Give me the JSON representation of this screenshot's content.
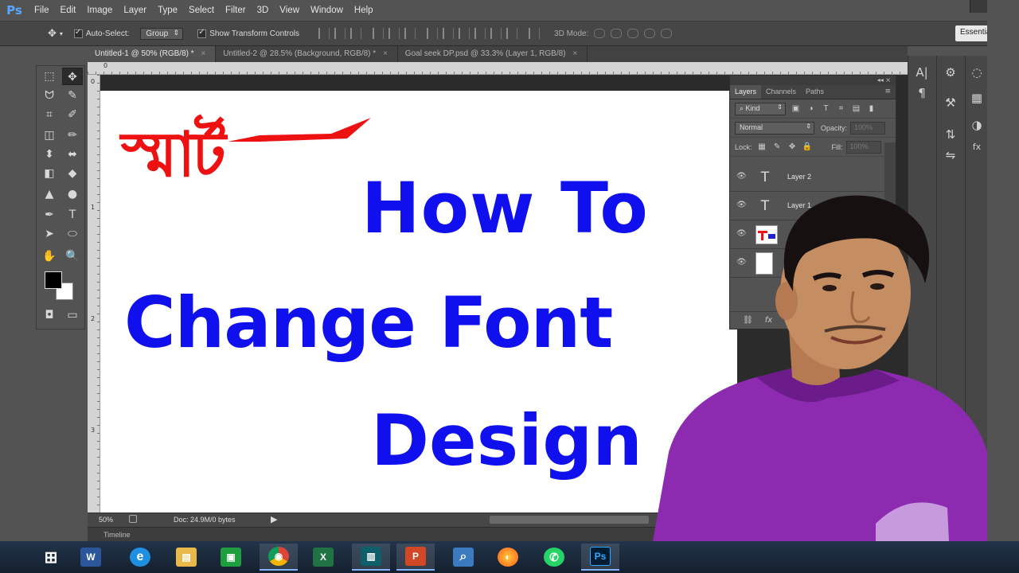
{
  "app": {
    "logo_text": "Ps",
    "menu": [
      "File",
      "Edit",
      "Image",
      "Layer",
      "Type",
      "Select",
      "Filter",
      "3D",
      "View",
      "Window",
      "Help"
    ]
  },
  "options_bar": {
    "auto_select_label": "Auto-Select:",
    "auto_select_target": "Group",
    "show_transform_label": "Show Transform Controls",
    "three_d_mode_label": "3D Mode:",
    "workspace_label": "Essentials"
  },
  "tabs": [
    {
      "label": "Untitled-1 @ 50% (RGB/8) *",
      "active": true
    },
    {
      "label": "Untitled-2 @ 28.5% (Background, RGB/8) *",
      "active": false
    },
    {
      "label": "Goal seek DP.psd @ 33.3% (Layer 1, RGB/8)",
      "active": false
    }
  ],
  "tab_close_glyph": "×",
  "rulers": {
    "top_first_tick": "0",
    "left_ticks": [
      "0",
      "1",
      "2",
      "3"
    ]
  },
  "canvas": {
    "bangla_word": "স্মার্ট",
    "headline_1": "How To",
    "headline_2": "Change Font",
    "headline_3": "Design",
    "headline_color": "#1010ee",
    "bangla_color": "#ee1111"
  },
  "status": {
    "zoom": "50%",
    "doc_info": "Doc: 24.9M/0 bytes",
    "arrow": "▶"
  },
  "timeline_label": "Timeline",
  "layers_panel": {
    "collapse_glyph": "◂◂  ×",
    "tabs": [
      "Layers",
      "Channels",
      "Paths"
    ],
    "menu_glyph": "≡",
    "filter_kind": "Kind",
    "blend_mode": "Normal",
    "opacity_label": "Opacity:",
    "opacity_value": "100%",
    "lock_label": "Lock:",
    "fill_label": "Fill:",
    "fill_value": "100%",
    "layers": [
      {
        "name": "Layer 2",
        "thumb": "T"
      },
      {
        "name": "Layer 1",
        "thumb": "T"
      },
      {
        "name": "",
        "thumb": "img"
      },
      {
        "name": "",
        "thumb": "bg"
      }
    ],
    "eye_glyph": "👁"
  },
  "tools": {
    "glyphs": [
      "⬚",
      "✥",
      "ᗢ",
      "✎",
      "⌗",
      "✐",
      "◫",
      "✏",
      "⬍",
      "⬌",
      "◧",
      "◆",
      "▲",
      "●",
      "✒",
      "T",
      "➤",
      "⬭",
      "✋",
      "🔍"
    ],
    "quickmask_glyph": "◘",
    "screenmode_glyph": "▭"
  },
  "dock": {
    "col1": [
      "A|",
      "¶"
    ],
    "col2": [
      "⚙",
      "⚒",
      "⇅",
      "⇋"
    ],
    "col3": [
      "◌",
      "▦",
      "◑",
      "fx"
    ]
  },
  "taskbar": {
    "apps": [
      {
        "name": "windows-start",
        "label": "⊞",
        "color": "#ffffff"
      },
      {
        "name": "word",
        "label": "W",
        "color": "#2b579a"
      },
      {
        "name": "internet-explorer",
        "label": "e",
        "color": "#1e8fe1"
      },
      {
        "name": "file-explorer",
        "label": "▤",
        "color": "#e8b84a"
      },
      {
        "name": "store",
        "label": "▣",
        "color": "#1e9e3e"
      },
      {
        "name": "chrome",
        "label": "◉",
        "color": "#db4437"
      },
      {
        "name": "excel",
        "label": "X",
        "color": "#1f7244"
      },
      {
        "name": "book-reader",
        "label": "▥",
        "color": "#0e5f6a"
      },
      {
        "name": "powerpoint",
        "label": "P",
        "color": "#d24726"
      },
      {
        "name": "search-tool",
        "label": "⌕",
        "color": "#3a7bbf"
      },
      {
        "name": "firefox",
        "label": "◐",
        "color": "#ff7a1a"
      },
      {
        "name": "whatsapp",
        "label": "✆",
        "color": "#25d366"
      },
      {
        "name": "photoshop",
        "label": "Ps",
        "color": "#001d34"
      }
    ]
  }
}
